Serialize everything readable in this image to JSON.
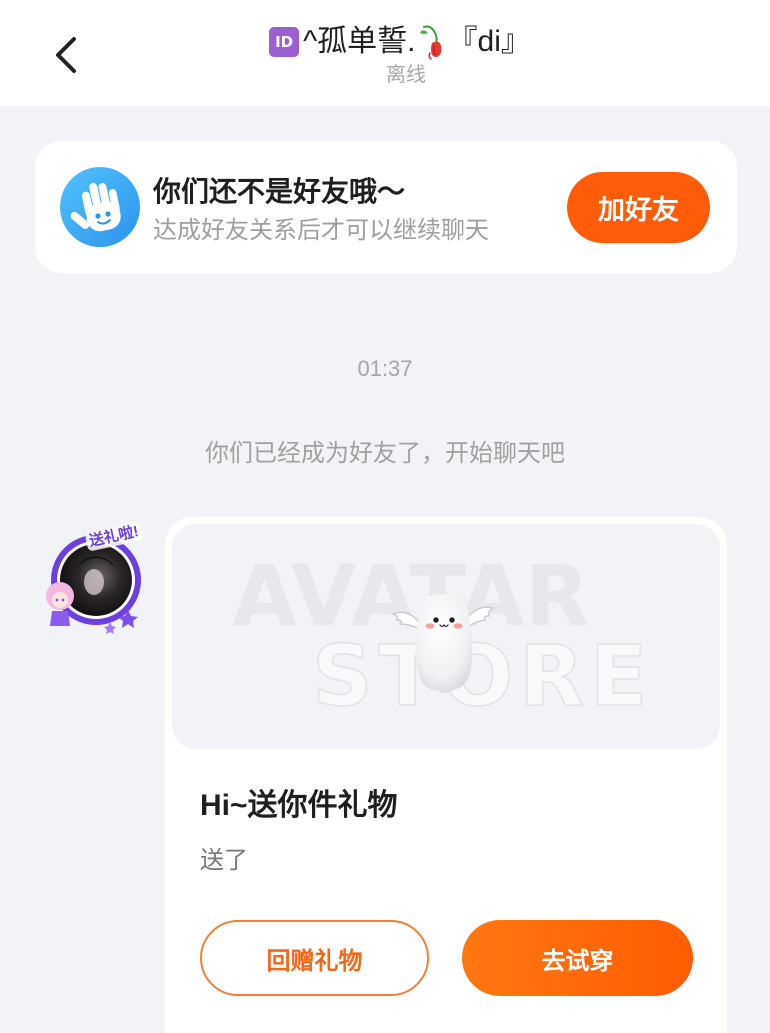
{
  "theme": {
    "accent": "#ff5c0a",
    "background": "#f2f3f7",
    "notice_icon_color": "#3aa8f5",
    "id_badge_color": "#9b5fd0"
  },
  "header": {
    "back_icon": "chevron-left-icon",
    "title_badge": "ID",
    "title_text": "^孤单誓.",
    "title_icon": "wilted-rose-icon",
    "title_suffix": "『di』",
    "status": "离线"
  },
  "friend_notice": {
    "icon": "waving-hand-icon",
    "title": "你们还不是好友哦～",
    "subtitle": "达成好友关系后才可以继续聊天",
    "add_button_label": "加好友"
  },
  "chat": {
    "timestamp": "01:37",
    "system_message": "你们已经成为好友了，开始聊天吧"
  },
  "gift_message": {
    "avatar_badge": "送礼啦!",
    "watermark": [
      "AVATAR",
      "STORE"
    ],
    "item_image": "ghost-plush-item",
    "title": "Hi~送你件礼物",
    "subtitle": "送了",
    "return_gift_label": "回赠礼物",
    "try_on_label": "去试穿"
  }
}
